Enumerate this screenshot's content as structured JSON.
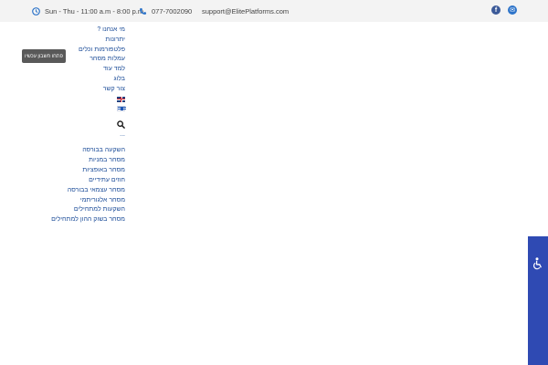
{
  "topbar": {
    "hours": "Sun - Thu - 11:00 a.m - 8:00 p.m",
    "phone": "077-7002090",
    "email": "support@ElitePlatforms.com",
    "social_icons": [
      "facebook-icon",
      "email-icon"
    ],
    "facebook_glyph": "f",
    "email_glyph": "✉",
    "colors": {
      "background": "#f3f3f3",
      "icon": "#2c73c9",
      "facebook": "#3b5998"
    }
  },
  "menu": {
    "items": [
      "מי אנחנו ?",
      "יתרונות",
      "פלטפורמות וכלים",
      "עמלות מסחר",
      "למד עוד",
      "בלוג",
      "צור קשר"
    ],
    "languages": [
      "english-flag-icon",
      "hebrew-flag-icon"
    ],
    "search_icon": "search-icon",
    "more": "...",
    "link_color": "#1f4f9a"
  },
  "submenu": {
    "items": [
      "השקעה בבורסה",
      "מסחר במניות",
      "מסחר באופציות",
      "חוזים עתידיים",
      "מסחר עצמאי בבורסה",
      "מסחר אלגוריתמי",
      "השקעות למתחילים",
      "מסחר בשוק ההון למתחילים"
    ]
  },
  "cta": {
    "open_account": "פתחו חשבון עכשיו",
    "color": "#595959"
  },
  "accessibility": {
    "icon": "accessibility-icon",
    "color": "#2f4ab3"
  }
}
